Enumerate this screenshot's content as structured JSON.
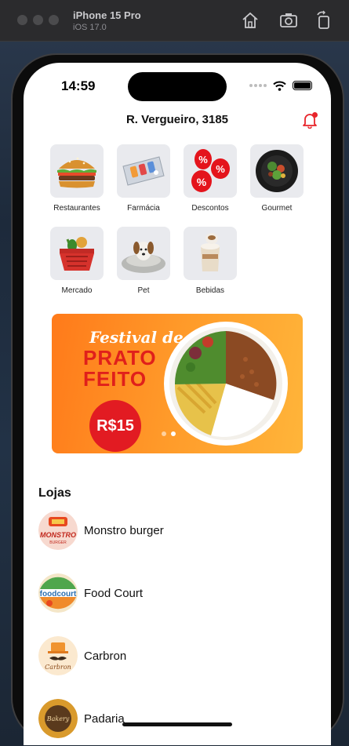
{
  "simulator": {
    "device": "iPhone 15 Pro",
    "os": "iOS 17.0",
    "icons": [
      "home-icon",
      "screenshot-icon",
      "rotate-icon"
    ]
  },
  "status_bar": {
    "time": "14:59"
  },
  "header": {
    "address": "R. Vergueiro, 3185"
  },
  "categories": [
    {
      "label": "Restaurantes",
      "icon": "burger-icon"
    },
    {
      "label": "Farmácia",
      "icon": "pharmacy-icon"
    },
    {
      "label": "Descontos",
      "icon": "discount-balloons-icon"
    },
    {
      "label": "Gourmet",
      "icon": "gourmet-dish-icon"
    },
    {
      "label": "Mercado",
      "icon": "grocery-basket-icon"
    },
    {
      "label": "Pet",
      "icon": "dog-bed-icon"
    },
    {
      "label": "Bebidas",
      "icon": "drinks-icon"
    }
  ],
  "banner": {
    "title_line1": "Festival de",
    "title_line2": "PRATO",
    "title_line3": "FEITO",
    "price": "R$15",
    "slide_count": 2,
    "active_slide": 2,
    "colors": {
      "background": "#ff8a22",
      "price": "#e21b22",
      "title": "#e0201b"
    }
  },
  "stores_section": {
    "title": "Lojas"
  },
  "stores": [
    {
      "name": "Monstro burger",
      "logo": "monstro-burger-logo"
    },
    {
      "name": "Food Court",
      "logo": "foodcourt-logo"
    },
    {
      "name": "Carbron",
      "logo": "carbron-logo"
    },
    {
      "name": "Padaria",
      "logo": "padaria-logo"
    }
  ],
  "accent_colors": {
    "bell": "#e8242a"
  }
}
